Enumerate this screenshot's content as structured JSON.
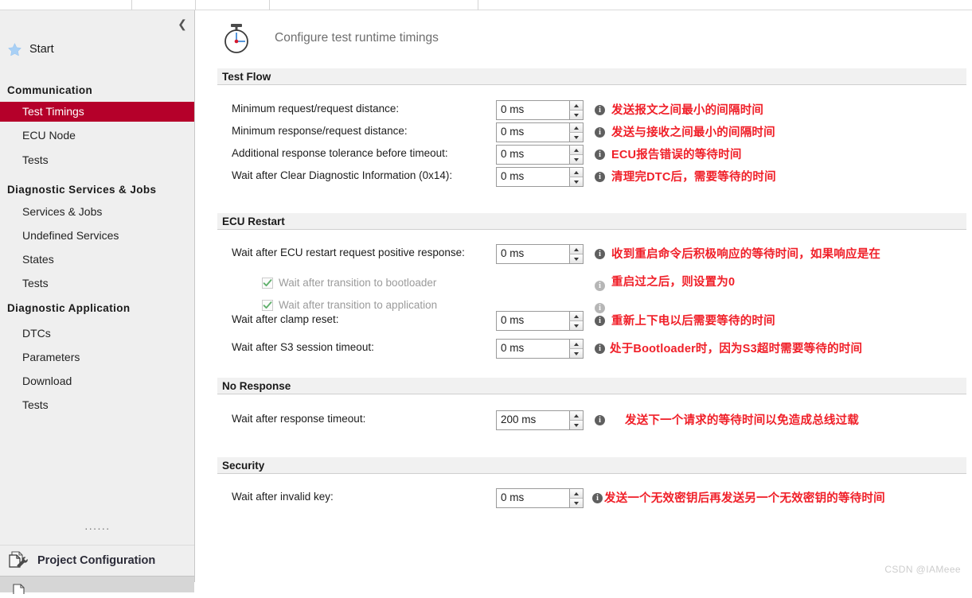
{
  "topbar": {
    "separators": [
      165,
      245,
      338,
      600
    ]
  },
  "sidebar": {
    "collapse_icon": "chevron-left-icon",
    "start": {
      "label": "Start",
      "icon": "star-icon"
    },
    "groups": [
      {
        "title": "Communication",
        "items": [
          {
            "label": "Test Timings",
            "selected": true
          },
          {
            "label": "ECU Node",
            "selected": false
          },
          {
            "label": "Tests",
            "selected": false
          }
        ]
      },
      {
        "title": "Diagnostic Services & Jobs",
        "items": [
          {
            "label": "Services & Jobs",
            "selected": false
          },
          {
            "label": "Undefined Services",
            "selected": false
          },
          {
            "label": "States",
            "selected": false
          },
          {
            "label": "Tests",
            "selected": false
          }
        ]
      },
      {
        "title": "Diagnostic Application",
        "items": [
          {
            "label": "DTCs",
            "selected": false
          },
          {
            "label": "Parameters",
            "selected": false
          },
          {
            "label": "Download",
            "selected": false
          },
          {
            "label": "Tests",
            "selected": false
          }
        ]
      }
    ],
    "dots": "......",
    "project_configuration": {
      "label": "Project Configuration",
      "icon": "document-wrench-icon"
    }
  },
  "header": {
    "icon": "stopwatch-icon",
    "title": "Configure test runtime timings"
  },
  "sections": [
    {
      "title": "Test Flow",
      "rows": [
        {
          "label": "Minimum request/request distance:",
          "value": "0 ms",
          "info": "info-icon",
          "annotation": "发送报文之间最小的间隔时间"
        },
        {
          "label": "Minimum response/request distance:",
          "value": "0 ms",
          "info": "info-icon",
          "annotation": "发送与接收之间最小的间隔时间"
        },
        {
          "label": "Additional response tolerance before timeout:",
          "value": "0 ms",
          "info": "info-icon",
          "annotation": "ECU报告错误的等待时间"
        },
        {
          "label": "Wait after Clear Diagnostic Information (0x14):",
          "value": "0 ms",
          "info": "info-icon",
          "annotation": "清理完DTC后，需要等待的时间"
        }
      ]
    },
    {
      "title": "ECU Restart",
      "rows": [
        {
          "label": "Wait after ECU restart request positive response:",
          "value": "0 ms",
          "info": "info-icon",
          "annotation": "收到重启命令后积极响应的等待时间，如果响应是在"
        },
        {
          "label": "Wait after clamp reset:",
          "value": "0 ms",
          "info": "info-icon",
          "annotation": "重新上下电以后需要等待的时间"
        },
        {
          "label": "Wait after S3 session timeout:",
          "value": "0 ms",
          "info": "info-icon",
          "annotation": "处于Bootloader时，因为S3超时需要等待的时间"
        }
      ],
      "checkboxes": [
        {
          "label": "Wait after transition to bootloader",
          "checked": true,
          "disabled": true,
          "info": "info-icon"
        },
        {
          "label": "Wait after transition to application",
          "checked": true,
          "disabled": true,
          "info": "info-icon"
        }
      ],
      "annotation_line2": "重启过之后，则设置为0"
    },
    {
      "title": "No Response",
      "rows": [
        {
          "label": "Wait after response timeout:",
          "value": "200 ms",
          "info": "info-icon",
          "annotation": "发送下一个请求的等待时间以免造成总线过载"
        }
      ]
    },
    {
      "title": "Security",
      "rows": [
        {
          "label": "Wait after invalid key:",
          "value": "0 ms",
          "info": "info-icon",
          "annotation": "发送一个无效密钥后再发送另一个无效密钥的等待时间"
        }
      ]
    }
  ],
  "watermark": "CSDN @IAMeee",
  "colors": {
    "accent": "#b5002a",
    "annotation": "#f01f28",
    "sidebar_bg": "#efefef",
    "section_bg": "#f1f1f1"
  }
}
